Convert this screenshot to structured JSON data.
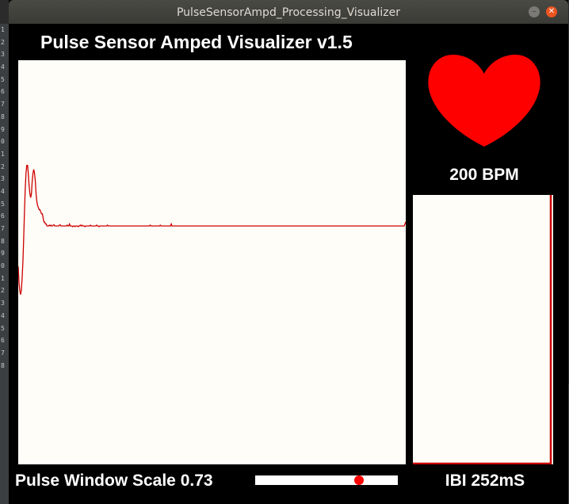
{
  "window": {
    "title": "PulseSensorAmpd_Processing_Visualizer"
  },
  "background_editor": {
    "line_numbers": [
      "1",
      "2",
      "3",
      "4",
      "5",
      "6",
      "7",
      "8",
      "9",
      "0",
      "1",
      "2",
      "3",
      "4",
      "5",
      "6",
      "7",
      "8",
      "9",
      "0",
      "1",
      "2",
      "3",
      "4",
      "5",
      "6",
      "7",
      "8"
    ]
  },
  "app": {
    "heading": "Pulse Sensor Amped Visualizer v1.5",
    "bpm_text": "200 BPM",
    "ibi_text": "IBI 252mS",
    "scale_text": "Pulse Window Scale 0.73",
    "scale_value": 0.73,
    "heart_color": "#ff0000",
    "trace_color": "#cc0000",
    "panel_color": "#fffdf7"
  },
  "waveform": {
    "samples": [
      0.49,
      0.45,
      0.43,
      0.42,
      0.43,
      0.46,
      0.5,
      0.56,
      0.62,
      0.68,
      0.72,
      0.74,
      0.74,
      0.72,
      0.69,
      0.67,
      0.66,
      0.67,
      0.7,
      0.72,
      0.73,
      0.72,
      0.7,
      0.67,
      0.65,
      0.64,
      0.635,
      0.63,
      0.63,
      0.625,
      0.62,
      0.62,
      0.61,
      0.6,
      0.6,
      0.595,
      0.595,
      0.59,
      0.59,
      0.59,
      0.592,
      0.59,
      0.592,
      0.59,
      0.59,
      0.592,
      0.593,
      0.59,
      0.59,
      0.59,
      0.59,
      0.59,
      0.59,
      0.592,
      0.593,
      0.59,
      0.59,
      0.59,
      0.59,
      0.59,
      0.59,
      0.59,
      0.59,
      0.592,
      0.59,
      0.59,
      0.595,
      0.59,
      0.59,
      0.59,
      0.588,
      0.59,
      0.59,
      0.588,
      0.59,
      0.59,
      0.59,
      0.588,
      0.59,
      0.59,
      0.592,
      0.59,
      0.592,
      0.59,
      0.59,
      0.59,
      0.588,
      0.59,
      0.59,
      0.59,
      0.59,
      0.59,
      0.59,
      0.592,
      0.59,
      0.59,
      0.59,
      0.59,
      0.59,
      0.59,
      0.59,
      0.592,
      0.59,
      0.59,
      0.588,
      0.59,
      0.59,
      0.59,
      0.59,
      0.59,
      0.59,
      0.59,
      0.59,
      0.59,
      0.59,
      0.592,
      0.59,
      0.59,
      0.59,
      0.59,
      0.59,
      0.59,
      0.59,
      0.59,
      0.59,
      0.59,
      0.59,
      0.59,
      0.59,
      0.59,
      0.59,
      0.59,
      0.59,
      0.59,
      0.59,
      0.59,
      0.59,
      0.59,
      0.59,
      0.59,
      0.59,
      0.59,
      0.59,
      0.59,
      0.59,
      0.59,
      0.59,
      0.59,
      0.59,
      0.59,
      0.59,
      0.59,
      0.59,
      0.59,
      0.59,
      0.59,
      0.59,
      0.59,
      0.59,
      0.59,
      0.59,
      0.59,
      0.59,
      0.59,
      0.59,
      0.59,
      0.59,
      0.59,
      0.59,
      0.59,
      0.592,
      0.59,
      0.59,
      0.59,
      0.59,
      0.59,
      0.59,
      0.59,
      0.59,
      0.59,
      0.59,
      0.59,
      0.59,
      0.592,
      0.59,
      0.59,
      0.59,
      0.59,
      0.59,
      0.59,
      0.59,
      0.59,
      0.59,
      0.59,
      0.59,
      0.59,
      0.59,
      0.595,
      0.59,
      0.59,
      0.59,
      0.59,
      0.59,
      0.59,
      0.59,
      0.59,
      0.59,
      0.59,
      0.59,
      0.59,
      0.59,
      0.59,
      0.59,
      0.59,
      0.59,
      0.59,
      0.59,
      0.59,
      0.59,
      0.59,
      0.59,
      0.59,
      0.59,
      0.59,
      0.59,
      0.59,
      0.59,
      0.59,
      0.59,
      0.59,
      0.59,
      0.59,
      0.59,
      0.59,
      0.59,
      0.59,
      0.59,
      0.59,
      0.59,
      0.59,
      0.59,
      0.59,
      0.59,
      0.59,
      0.59,
      0.59,
      0.59,
      0.59,
      0.59,
      0.59,
      0.59,
      0.59,
      0.59,
      0.59,
      0.59,
      0.59,
      0.59,
      0.59,
      0.59,
      0.59,
      0.59,
      0.59,
      0.59,
      0.59,
      0.59,
      0.59,
      0.59,
      0.59,
      0.59,
      0.59,
      0.59,
      0.59,
      0.59,
      0.59,
      0.59,
      0.59,
      0.59,
      0.59,
      0.59,
      0.59,
      0.59,
      0.59,
      0.59,
      0.59,
      0.59,
      0.59,
      0.59,
      0.59,
      0.59,
      0.59,
      0.59,
      0.59,
      0.59,
      0.59,
      0.59,
      0.59,
      0.59,
      0.59,
      0.59,
      0.59,
      0.59,
      0.59,
      0.59,
      0.59,
      0.59,
      0.59,
      0.59,
      0.59,
      0.59,
      0.59,
      0.59,
      0.59,
      0.59,
      0.59,
      0.59,
      0.59,
      0.59,
      0.59,
      0.59,
      0.59,
      0.59,
      0.59,
      0.59,
      0.59,
      0.59,
      0.59,
      0.59,
      0.59,
      0.59,
      0.59,
      0.59,
      0.59,
      0.59,
      0.59,
      0.59,
      0.59,
      0.59,
      0.59,
      0.59,
      0.59,
      0.59,
      0.59,
      0.59,
      0.59,
      0.59,
      0.59,
      0.59,
      0.59,
      0.59,
      0.59,
      0.59,
      0.59,
      0.59,
      0.59,
      0.59,
      0.59,
      0.59,
      0.59,
      0.59,
      0.59,
      0.59,
      0.59,
      0.59,
      0.59,
      0.59,
      0.59,
      0.59,
      0.59,
      0.59,
      0.59,
      0.59,
      0.59,
      0.59,
      0.59,
      0.59,
      0.59,
      0.59,
      0.59,
      0.59,
      0.59,
      0.59,
      0.59,
      0.59,
      0.59,
      0.59,
      0.59,
      0.59,
      0.59,
      0.59,
      0.59,
      0.59,
      0.59,
      0.59,
      0.59,
      0.59,
      0.59,
      0.59,
      0.59,
      0.59,
      0.59,
      0.59,
      0.59,
      0.59,
      0.59,
      0.59,
      0.59,
      0.59,
      0.59,
      0.59,
      0.59,
      0.59,
      0.59,
      0.59,
      0.59,
      0.59,
      0.59,
      0.59,
      0.59,
      0.59,
      0.59,
      0.59,
      0.59,
      0.59,
      0.59,
      0.59,
      0.59,
      0.59,
      0.59,
      0.59,
      0.59,
      0.59,
      0.59,
      0.59,
      0.59,
      0.59,
      0.59,
      0.59,
      0.59,
      0.59,
      0.59,
      0.59,
      0.59,
      0.59,
      0.59,
      0.59,
      0.59,
      0.59,
      0.59,
      0.59,
      0.59,
      0.59,
      0.59,
      0.59,
      0.59,
      0.59,
      0.59,
      0.59,
      0.59,
      0.59,
      0.59,
      0.59,
      0.59,
      0.59,
      0.59,
      0.59,
      0.59,
      0.59,
      0.59,
      0.59,
      0.59,
      0.59,
      0.59,
      0.59,
      0.59,
      0.59,
      0.59,
      0.59,
      0.59,
      0.59,
      0.59,
      0.59,
      0.59,
      0.59,
      0.59,
      0.59,
      0.59,
      0.59,
      0.59,
      0.59,
      0.59,
      0.59,
      0.59,
      0.59,
      0.59,
      0.59,
      0.59,
      0.59,
      0.59,
      0.595,
      0.6
    ]
  }
}
